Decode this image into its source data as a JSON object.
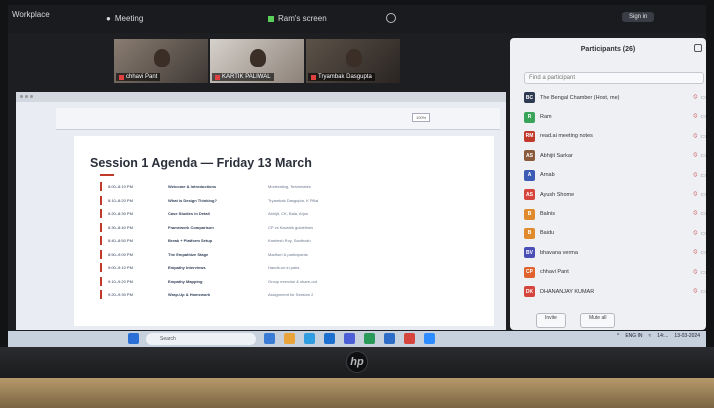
{
  "window": {
    "app_title": "Workplace",
    "meeting_label": "Meeting",
    "share_label": "Ram's screen",
    "sign_in": "Sign in"
  },
  "tiles": [
    {
      "name": "chhavi Pant"
    },
    {
      "name": "KARTIK PALIWAL"
    },
    {
      "name": "Tryambak Dasgupta"
    }
  ],
  "doc": {
    "title": "Session 1 Agenda — Friday 13 March",
    "zoom": "100%",
    "rows": [
      {
        "time": "8:00–8:10 PM",
        "topic": "Welcome & Introductions",
        "owner": "Moderating, Teammates"
      },
      {
        "time": "8:10–8:20 PM",
        "topic": "What is Design Thinking?",
        "owner": "Tryambak Dasgupta, K Pillai"
      },
      {
        "time": "8:20–8:30 PM",
        "topic": "Case Studies in Detail",
        "owner": "Abhijit, CK, Bala, Arjun"
      },
      {
        "time": "8:30–8:40 PM",
        "topic": "Framework Comparison",
        "owner": "CP vs Kaushik guidelines"
      },
      {
        "time": "8:40–8:50 PM",
        "topic": "Break + Platform Setup",
        "owner": "Kamlesh Roy, Santhosh"
      },
      {
        "time": "8:50–9:00 PM",
        "topic": "The Empathize Stage",
        "owner": "Madhuri & participants"
      },
      {
        "time": "9:00–9:10 PM",
        "topic": "Empathy Interviews",
        "owner": "Hands-on in pairs"
      },
      {
        "time": "9:10–9:20 PM",
        "topic": "Empathy Mapping",
        "owner": "Group exercise & share-out"
      },
      {
        "time": "9:20–9:30 PM",
        "topic": "Wrap-Up & Homework",
        "owner": "Assignment for Session 2"
      }
    ]
  },
  "panel": {
    "title": "Participants (26)",
    "search_placeholder": "Find a participant",
    "invite": "Invite",
    "mute_all": "Mute all",
    "participants": [
      {
        "initials": "BC",
        "name": "The Bengal Chamber (Host, me)",
        "color": "#2f3b52"
      },
      {
        "initials": "R",
        "name": "Ram",
        "color": "#3aa35a"
      },
      {
        "initials": "RM",
        "name": "read.ai meeting notes",
        "color": "#c0392b"
      },
      {
        "initials": "AS",
        "name": "Abhijit Sarkar",
        "color": "#8a5a3c"
      },
      {
        "initials": "A",
        "name": "Arnab",
        "color": "#3b5bb5"
      },
      {
        "initials": "AS",
        "name": "Ayush Shome",
        "color": "#d6453d"
      },
      {
        "initials": "B",
        "name": "Balnis",
        "color": "#e08a2e"
      },
      {
        "initials": "B",
        "name": "Baidu",
        "color": "#e08a2e"
      },
      {
        "initials": "BV",
        "name": "bhavana verma",
        "color": "#4b4fb5"
      },
      {
        "initials": "CP",
        "name": "chhavi Pant",
        "color": "#e0622e"
      },
      {
        "initials": "DK",
        "name": "DHANANJAY KUMAR",
        "color": "#d6453d"
      }
    ]
  },
  "taskbar": {
    "search": "Search",
    "lang": "ENG IN",
    "time": "14:...",
    "date": "13-03-2024"
  }
}
